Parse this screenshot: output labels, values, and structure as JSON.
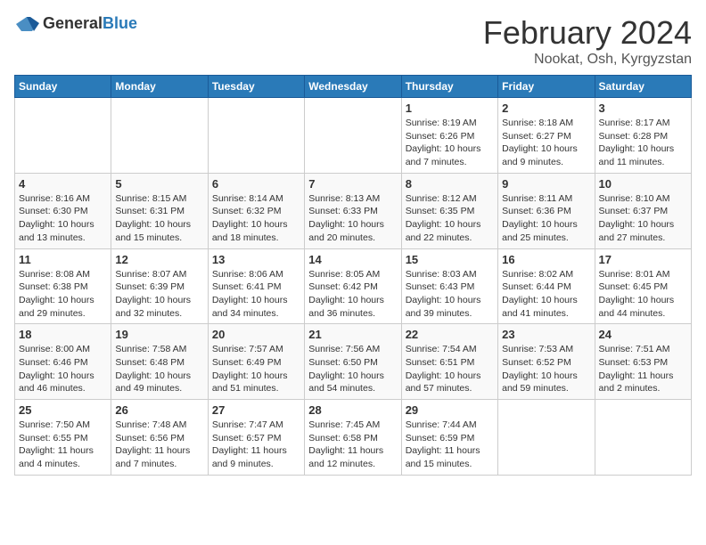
{
  "header": {
    "logo_general": "General",
    "logo_blue": "Blue",
    "month_title": "February 2024",
    "subtitle": "Nookat, Osh, Kyrgyzstan"
  },
  "weekdays": [
    "Sunday",
    "Monday",
    "Tuesday",
    "Wednesday",
    "Thursday",
    "Friday",
    "Saturday"
  ],
  "weeks": [
    [
      {
        "day": "",
        "info": ""
      },
      {
        "day": "",
        "info": ""
      },
      {
        "day": "",
        "info": ""
      },
      {
        "day": "",
        "info": ""
      },
      {
        "day": "1",
        "info": "Sunrise: 8:19 AM\nSunset: 6:26 PM\nDaylight: 10 hours\nand 7 minutes."
      },
      {
        "day": "2",
        "info": "Sunrise: 8:18 AM\nSunset: 6:27 PM\nDaylight: 10 hours\nand 9 minutes."
      },
      {
        "day": "3",
        "info": "Sunrise: 8:17 AM\nSunset: 6:28 PM\nDaylight: 10 hours\nand 11 minutes."
      }
    ],
    [
      {
        "day": "4",
        "info": "Sunrise: 8:16 AM\nSunset: 6:30 PM\nDaylight: 10 hours\nand 13 minutes."
      },
      {
        "day": "5",
        "info": "Sunrise: 8:15 AM\nSunset: 6:31 PM\nDaylight: 10 hours\nand 15 minutes."
      },
      {
        "day": "6",
        "info": "Sunrise: 8:14 AM\nSunset: 6:32 PM\nDaylight: 10 hours\nand 18 minutes."
      },
      {
        "day": "7",
        "info": "Sunrise: 8:13 AM\nSunset: 6:33 PM\nDaylight: 10 hours\nand 20 minutes."
      },
      {
        "day": "8",
        "info": "Sunrise: 8:12 AM\nSunset: 6:35 PM\nDaylight: 10 hours\nand 22 minutes."
      },
      {
        "day": "9",
        "info": "Sunrise: 8:11 AM\nSunset: 6:36 PM\nDaylight: 10 hours\nand 25 minutes."
      },
      {
        "day": "10",
        "info": "Sunrise: 8:10 AM\nSunset: 6:37 PM\nDaylight: 10 hours\nand 27 minutes."
      }
    ],
    [
      {
        "day": "11",
        "info": "Sunrise: 8:08 AM\nSunset: 6:38 PM\nDaylight: 10 hours\nand 29 minutes."
      },
      {
        "day": "12",
        "info": "Sunrise: 8:07 AM\nSunset: 6:39 PM\nDaylight: 10 hours\nand 32 minutes."
      },
      {
        "day": "13",
        "info": "Sunrise: 8:06 AM\nSunset: 6:41 PM\nDaylight: 10 hours\nand 34 minutes."
      },
      {
        "day": "14",
        "info": "Sunrise: 8:05 AM\nSunset: 6:42 PM\nDaylight: 10 hours\nand 36 minutes."
      },
      {
        "day": "15",
        "info": "Sunrise: 8:03 AM\nSunset: 6:43 PM\nDaylight: 10 hours\nand 39 minutes."
      },
      {
        "day": "16",
        "info": "Sunrise: 8:02 AM\nSunset: 6:44 PM\nDaylight: 10 hours\nand 41 minutes."
      },
      {
        "day": "17",
        "info": "Sunrise: 8:01 AM\nSunset: 6:45 PM\nDaylight: 10 hours\nand 44 minutes."
      }
    ],
    [
      {
        "day": "18",
        "info": "Sunrise: 8:00 AM\nSunset: 6:46 PM\nDaylight: 10 hours\nand 46 minutes."
      },
      {
        "day": "19",
        "info": "Sunrise: 7:58 AM\nSunset: 6:48 PM\nDaylight: 10 hours\nand 49 minutes."
      },
      {
        "day": "20",
        "info": "Sunrise: 7:57 AM\nSunset: 6:49 PM\nDaylight: 10 hours\nand 51 minutes."
      },
      {
        "day": "21",
        "info": "Sunrise: 7:56 AM\nSunset: 6:50 PM\nDaylight: 10 hours\nand 54 minutes."
      },
      {
        "day": "22",
        "info": "Sunrise: 7:54 AM\nSunset: 6:51 PM\nDaylight: 10 hours\nand 57 minutes."
      },
      {
        "day": "23",
        "info": "Sunrise: 7:53 AM\nSunset: 6:52 PM\nDaylight: 10 hours\nand 59 minutes."
      },
      {
        "day": "24",
        "info": "Sunrise: 7:51 AM\nSunset: 6:53 PM\nDaylight: 11 hours\nand 2 minutes."
      }
    ],
    [
      {
        "day": "25",
        "info": "Sunrise: 7:50 AM\nSunset: 6:55 PM\nDaylight: 11 hours\nand 4 minutes."
      },
      {
        "day": "26",
        "info": "Sunrise: 7:48 AM\nSunset: 6:56 PM\nDaylight: 11 hours\nand 7 minutes."
      },
      {
        "day": "27",
        "info": "Sunrise: 7:47 AM\nSunset: 6:57 PM\nDaylight: 11 hours\nand 9 minutes."
      },
      {
        "day": "28",
        "info": "Sunrise: 7:45 AM\nSunset: 6:58 PM\nDaylight: 11 hours\nand 12 minutes."
      },
      {
        "day": "29",
        "info": "Sunrise: 7:44 AM\nSunset: 6:59 PM\nDaylight: 11 hours\nand 15 minutes."
      },
      {
        "day": "",
        "info": ""
      },
      {
        "day": "",
        "info": ""
      }
    ]
  ]
}
